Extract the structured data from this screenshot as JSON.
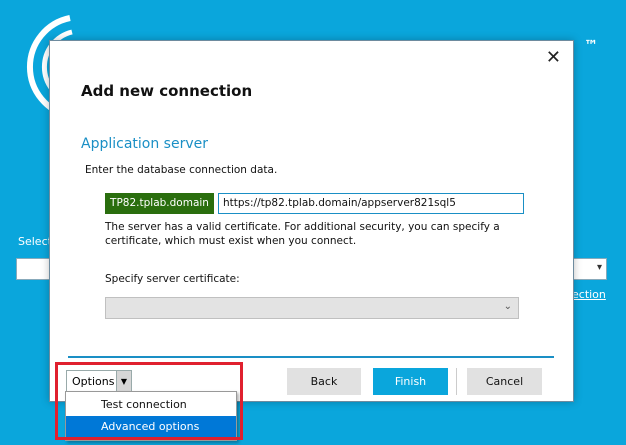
{
  "background": {
    "trademark": "™",
    "select_label": "Select",
    "link_text": "ection"
  },
  "dialog": {
    "title": "Add new connection",
    "section_title": "Application server",
    "instruction": "Enter the database connection data.",
    "domain_badge": "TP82.tplab.domain",
    "url_value": "https://tp82.tplab.domain/appserver821sql5",
    "cert_info": "The server has a valid certificate. For additional security, you can specify a certificate, which must exist when you connect.",
    "cert_label": "Specify server certificate:",
    "cert_value": "",
    "close_glyph": "✕"
  },
  "buttons": {
    "options": "Options",
    "back": "Back",
    "finish": "Finish",
    "cancel": "Cancel"
  },
  "options_menu": {
    "items": [
      {
        "label": "Test connection",
        "selected": false
      },
      {
        "label": "Advanced options",
        "selected": true
      }
    ]
  },
  "colors": {
    "background": "#0aa6dc",
    "accent": "#1a8fc5",
    "badge": "#2a6e0e",
    "selection": "#0078d7",
    "highlight": "#e0202e"
  },
  "icons": {
    "close": "close-icon",
    "dropdown": "chevron-down-icon",
    "logo": "logo-icon"
  }
}
